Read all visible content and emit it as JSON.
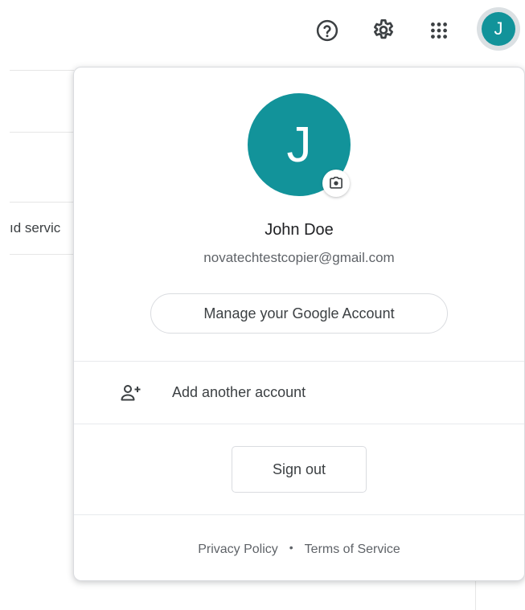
{
  "background": {
    "partial_text": "ıd servic"
  },
  "topbar": {
    "help_icon": "help-circle-icon",
    "settings_icon": "gear-icon",
    "apps_icon": "apps-grid-icon",
    "avatar_letter": "J"
  },
  "account": {
    "avatar_letter": "J",
    "avatar_color": "#12939a",
    "name": "John Doe",
    "email": "novatechtestcopier@gmail.com",
    "manage_label": "Manage your Google Account",
    "add_account_label": "Add another account",
    "sign_out_label": "Sign out"
  },
  "footer": {
    "privacy_label": "Privacy Policy",
    "separator": "•",
    "terms_label": "Terms of Service"
  }
}
